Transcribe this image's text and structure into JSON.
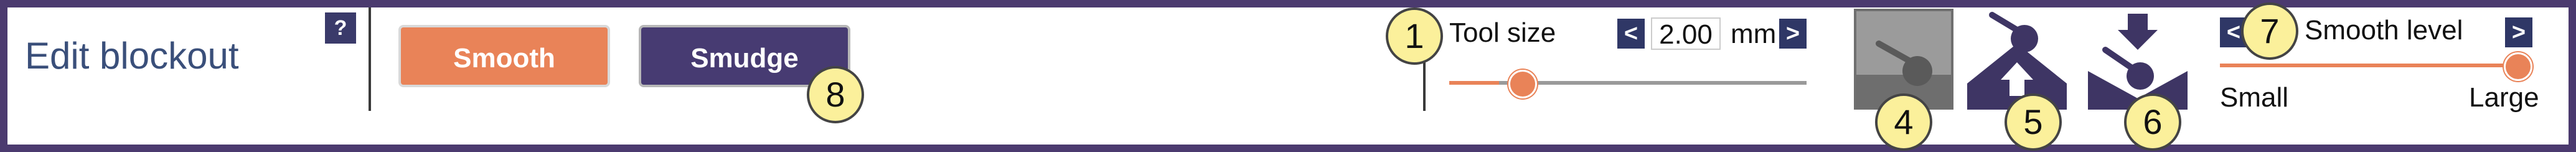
{
  "panel": {
    "title": "Edit blockout",
    "help_label": "?"
  },
  "modes": {
    "smooth_label": "Smooth",
    "smudge_label": "Smudge"
  },
  "tool_size": {
    "label": "Tool size",
    "value": "2.00",
    "unit": "mm",
    "decrease_label": "<",
    "increase_label": ">",
    "slider_level": 0.2
  },
  "tools": [
    {
      "name": "tool-flat",
      "icon": "flat-brush-icon",
      "active": true
    },
    {
      "name": "tool-add",
      "icon": "add-material-icon",
      "active": false
    },
    {
      "name": "tool-remove",
      "icon": "remove-material-icon",
      "active": false
    }
  ],
  "smooth_level": {
    "label": "Smooth level",
    "min_label": "Small",
    "max_label": "Large",
    "decrease_label": "<",
    "increase_label": ">",
    "slider_level": 1.0
  },
  "callouts": [
    "1",
    "4",
    "5",
    "6",
    "7",
    "8"
  ],
  "colors": {
    "frame": "#4b3a6f",
    "smooth": "#e98358",
    "smudge": "#473b72",
    "callout": "#fbf09b",
    "arrow_button": "#2f3766"
  }
}
